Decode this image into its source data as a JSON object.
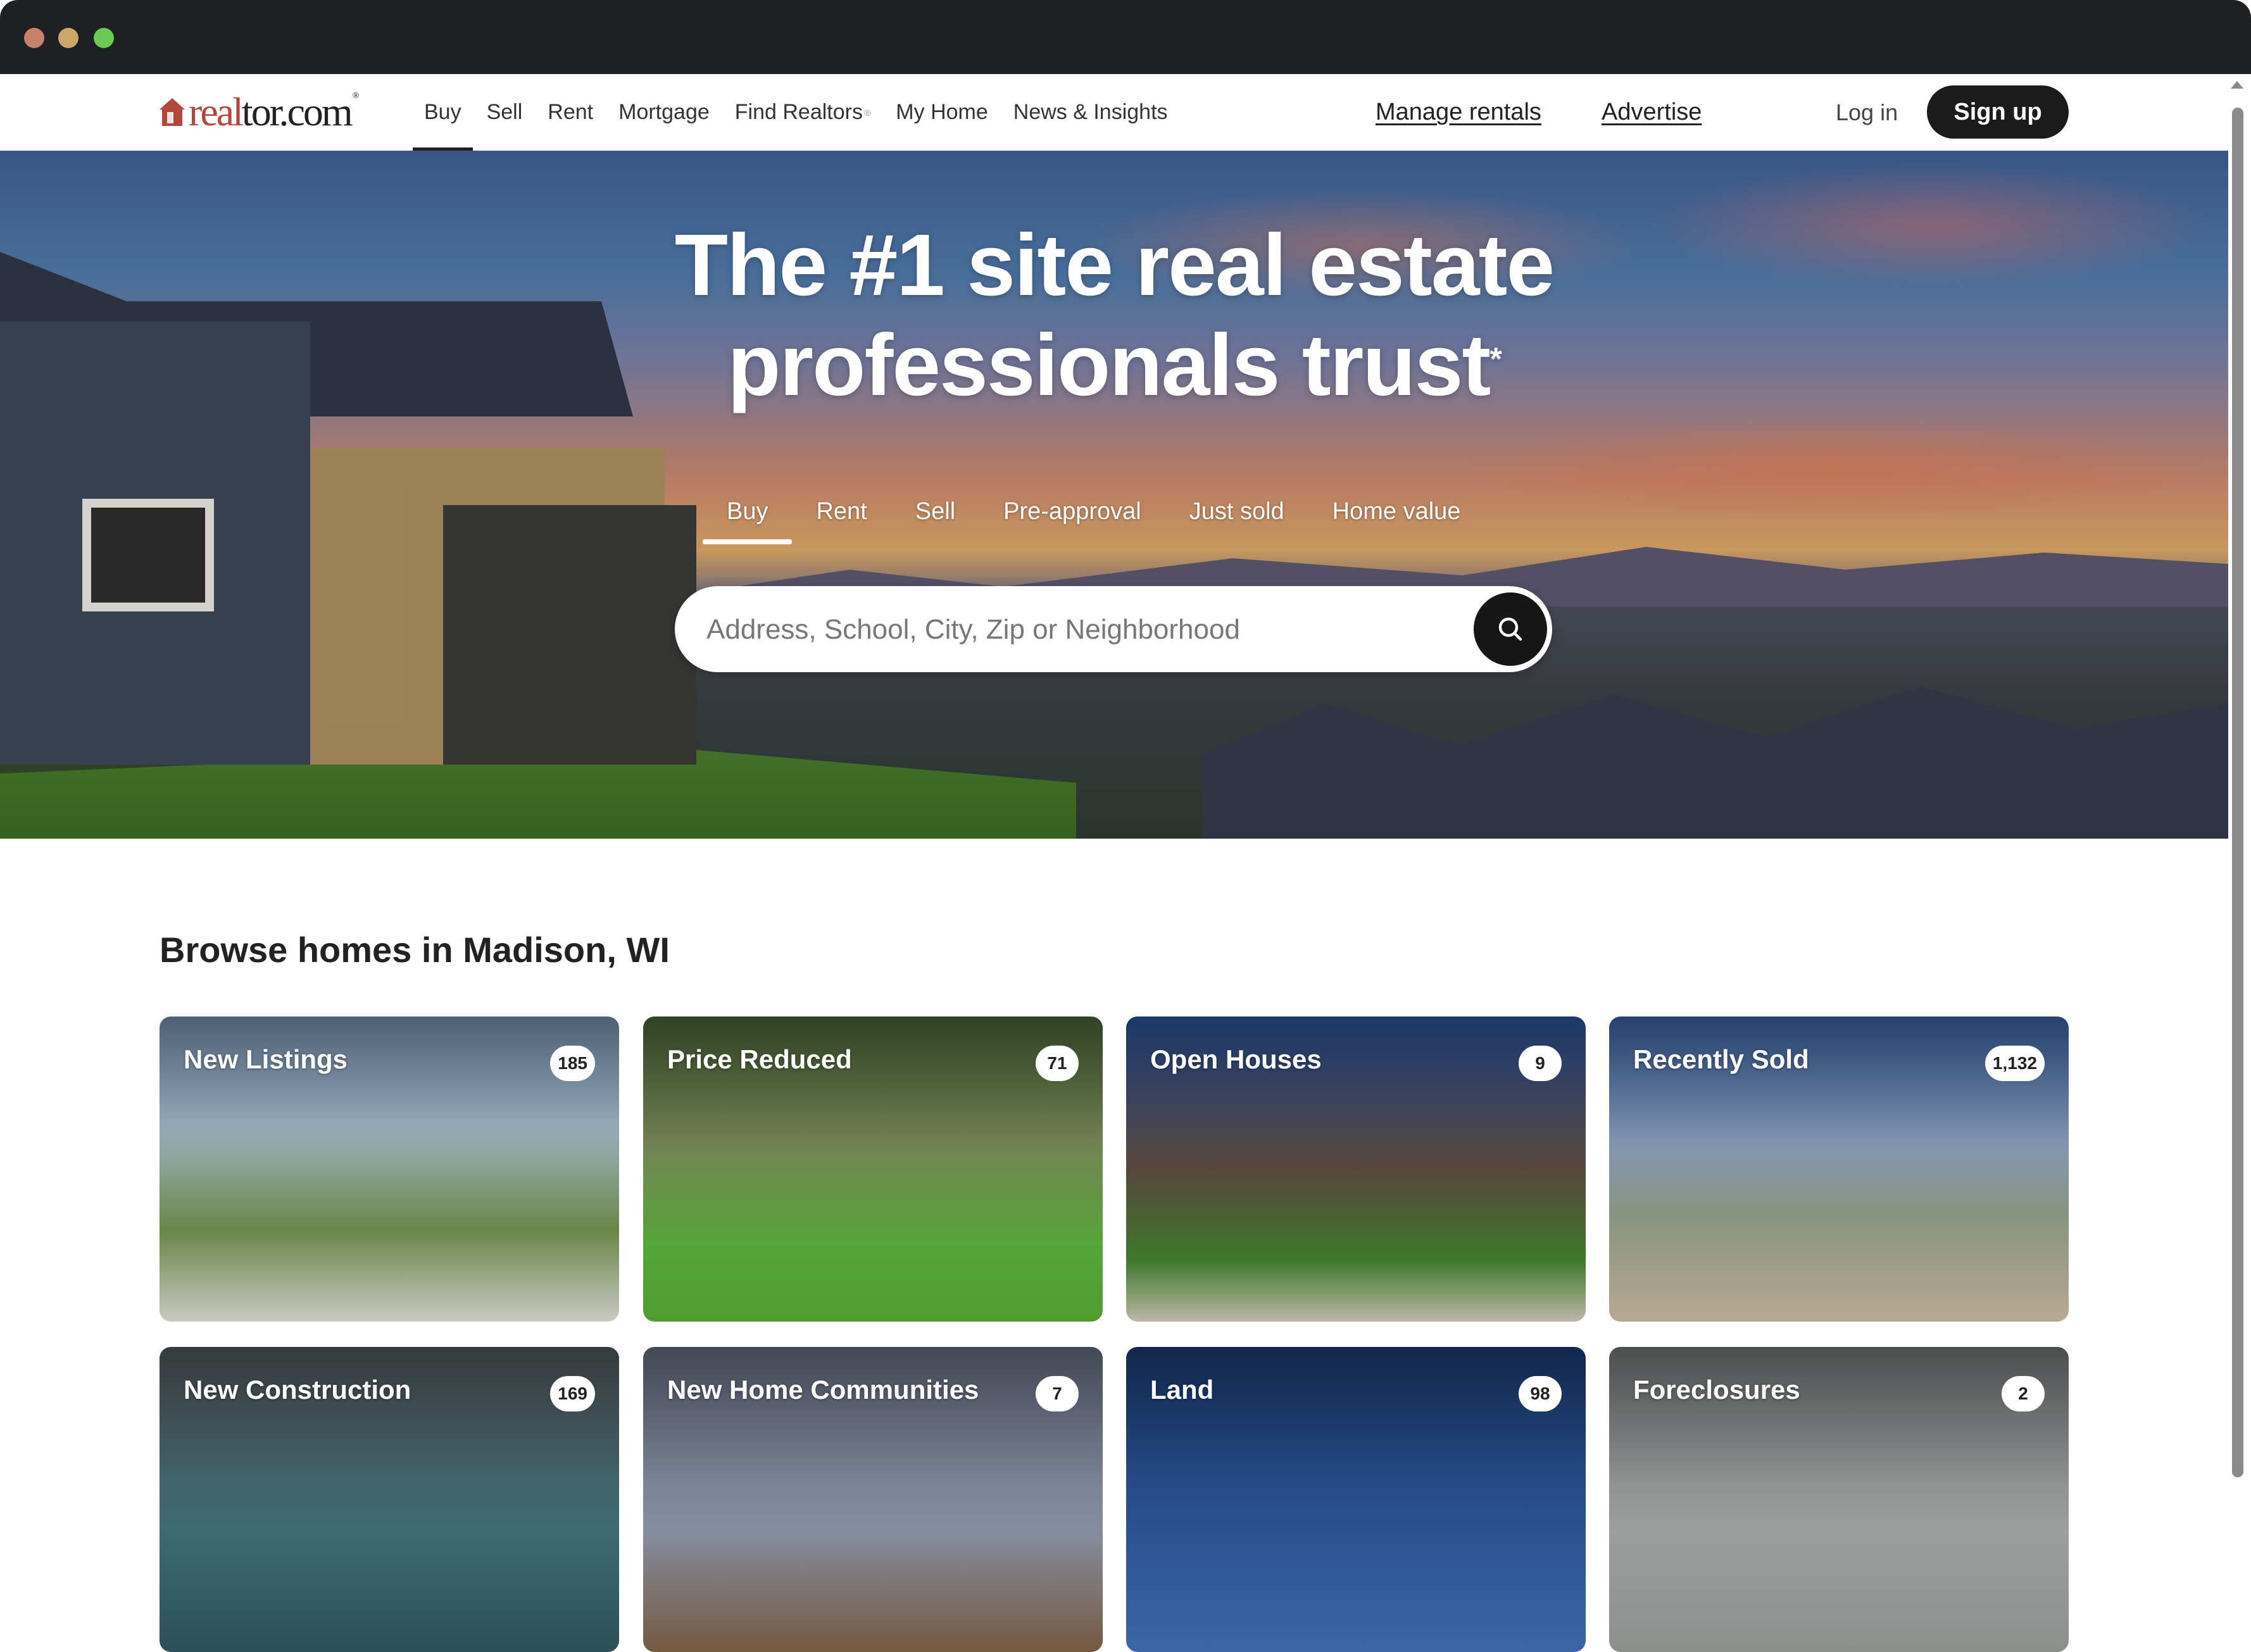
{
  "window": {
    "controls": [
      "close",
      "minimize",
      "maximize"
    ]
  },
  "nav": {
    "logo": {
      "part1": "real",
      "part2": "tor.com",
      "mark": "®",
      "icon": "house-logo-icon"
    },
    "links": [
      {
        "label": "Buy",
        "active": true
      },
      {
        "label": "Sell"
      },
      {
        "label": "Rent"
      },
      {
        "label": "Mortgage"
      },
      {
        "label": "Find Realtors",
        "sup": "®"
      },
      {
        "label": "My Home"
      },
      {
        "label": "News & Insights"
      }
    ],
    "manage_rentals": "Manage rentals",
    "advertise": "Advertise",
    "login": "Log in",
    "signup": "Sign up"
  },
  "hero": {
    "headline_line1": "The #1 site real estate",
    "headline_line2": "professionals trust",
    "headline_mark": "*",
    "tabs": [
      {
        "label": "Buy",
        "active": true
      },
      {
        "label": "Rent"
      },
      {
        "label": "Sell"
      },
      {
        "label": "Pre-approval"
      },
      {
        "label": "Just sold"
      },
      {
        "label": "Home value"
      }
    ],
    "search": {
      "placeholder": "Address, School, City, Zip or Neighborhood",
      "value": "",
      "button_icon": "search-icon"
    }
  },
  "browse": {
    "title": "Browse homes in Madison, WI",
    "cards": [
      {
        "label": "New Listings",
        "count": "185"
      },
      {
        "label": "Price Reduced",
        "count": "71"
      },
      {
        "label": "Open Houses",
        "count": "9"
      },
      {
        "label": "Recently Sold",
        "count": "1,132"
      },
      {
        "label": "New Construction",
        "count": "169"
      },
      {
        "label": "New Home Communities",
        "count": "7"
      },
      {
        "label": "Land",
        "count": "98"
      },
      {
        "label": "Foreclosures",
        "count": "2"
      }
    ]
  },
  "colors": {
    "brand_red": "#b3473a",
    "button_dark": "#1b1b1b",
    "titlebar": "#1f2023"
  }
}
